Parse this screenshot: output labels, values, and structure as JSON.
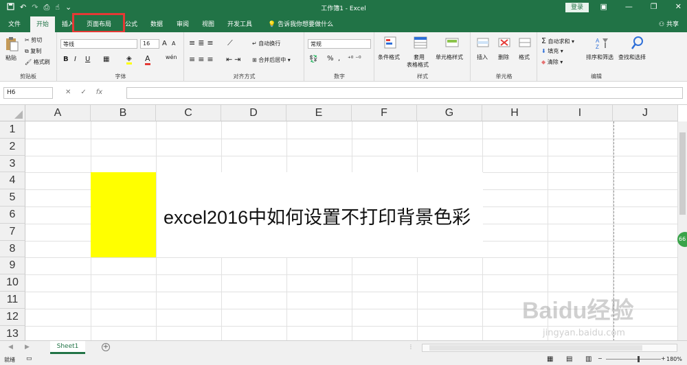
{
  "colors": {
    "brand": "#217346",
    "highlight": "#e53935",
    "cell_fill": "#ffff00"
  },
  "titlebar": {
    "title": "工作簿1 - Excel",
    "login": "登录",
    "qat_icons": [
      "save-icon",
      "undo-icon",
      "redo-icon",
      "print-preview-icon",
      "touch-mode-icon",
      "customize-icon"
    ]
  },
  "tabs": {
    "file": "文件",
    "home": "开始",
    "insert": "插入",
    "page_layout": "页面布局",
    "formulas": "公式",
    "data": "数据",
    "review": "审阅",
    "view": "视图",
    "developer": "开发工具",
    "tell_me": "告诉我你想要做什么",
    "share": "共享"
  },
  "ribbon": {
    "clipboard": {
      "label": "剪贴板",
      "paste": "粘贴",
      "cut": "剪切",
      "copy": "复制",
      "format_painter": "格式刷"
    },
    "font": {
      "label": "字体",
      "font_name": "等线",
      "font_size": "16",
      "bold": "B",
      "italic": "I",
      "underline": "U",
      "grow": "A",
      "shrink": "A",
      "font_color": "A",
      "phonetic": "wén"
    },
    "alignment": {
      "label": "对齐方式",
      "wrap": "自动换行",
      "merge": "合并后居中"
    },
    "number": {
      "label": "数字",
      "format": "常规",
      "percent": "%",
      "comma": ","
    },
    "styles": {
      "label": "样式",
      "conditional": "条件格式",
      "table1": "套用",
      "table2": "表格格式",
      "cell_styles": "单元格样式"
    },
    "cells": {
      "label": "单元格",
      "insert": "插入",
      "delete": "删除",
      "format": "格式"
    },
    "editing": {
      "label": "编辑",
      "autosum": "自动求和",
      "fill": "填充",
      "clear": "清除",
      "sort": "排序和筛选",
      "find": "查找和选择"
    }
  },
  "formula_bar": {
    "name_box": "H6",
    "fx": "fx",
    "value": ""
  },
  "grid": {
    "columns": [
      "A",
      "B",
      "C",
      "D",
      "E",
      "F",
      "G",
      "H",
      "I",
      "J"
    ],
    "rows": [
      "1",
      "2",
      "3",
      "4",
      "5",
      "6",
      "7",
      "8",
      "9",
      "10",
      "11",
      "12",
      "13"
    ],
    "merged_text": "excel2016中如何设置不打印背景色彩"
  },
  "sheets": {
    "active": "Sheet1"
  },
  "status": {
    "ready": "就绪",
    "zoom": "180%",
    "badge": "66"
  },
  "watermark": {
    "brand": "Baidu经验",
    "url": "jingyan.baidu.com"
  }
}
